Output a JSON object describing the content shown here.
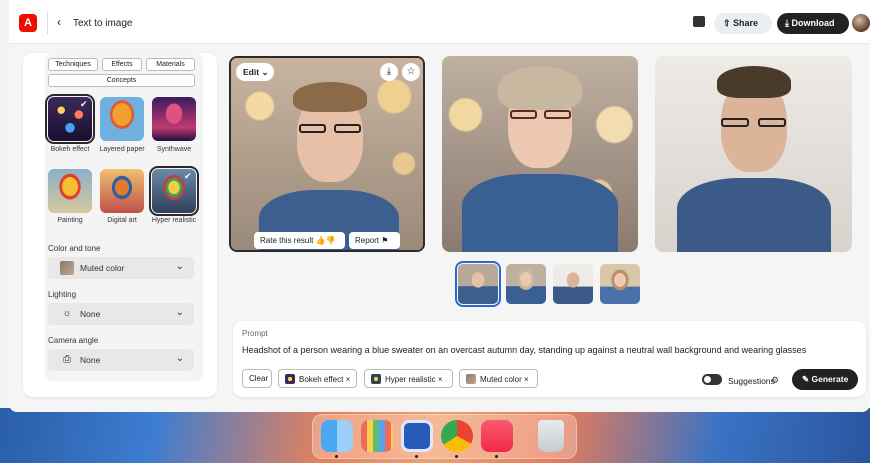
{
  "topbar": {
    "logo_icon": "adobe-firefly-logo",
    "back_icon": "chevron-left-icon",
    "breadcrumb": "Text to image",
    "comment_icon": "comment-icon",
    "share_label": "Share",
    "download_label": "Download"
  },
  "style_panel": {
    "tabs": [
      "Techniques",
      "Effects",
      "Materials",
      "Concepts"
    ],
    "styles": [
      {
        "label": "Bokeh effect",
        "selected": true
      },
      {
        "label": "Layered paper",
        "selected": false
      },
      {
        "label": "Synthwave",
        "selected": false
      },
      {
        "label": "Painting",
        "selected": false
      },
      {
        "label": "Digital art",
        "selected": false
      },
      {
        "label": "Hyper realistic",
        "selected": true
      }
    ],
    "color_tone": {
      "label": "Color and tone",
      "value": "Muted color"
    },
    "lighting": {
      "label": "Lighting",
      "value": "None"
    },
    "camera_angle": {
      "label": "Camera angle",
      "value": "None"
    }
  },
  "main_image": {
    "edit_label": "Edit",
    "rate_label": "Rate this result",
    "report_label": "Report"
  },
  "prompt": {
    "label": "Prompt",
    "text": "Headshot of a person wearing a blue sweater on an overcast autumn day, standing up against a neutral wall background and wearing glasses",
    "clear_label": "Clear",
    "chips": [
      "Bokeh effect",
      "Hyper realistic",
      "Muted color"
    ],
    "suggestions_label": "Suggestions",
    "suggestions_on": true,
    "generate_label": "Generate"
  },
  "dock": {
    "apps": [
      "finder",
      "launchpad",
      "tasks",
      "chrome",
      "music",
      "trash"
    ]
  },
  "colors": {
    "accent": "#2a66d6",
    "dark_button": "#222222",
    "adobe_red": "#eb1000",
    "sweater_blue": "#3d5f8f"
  }
}
